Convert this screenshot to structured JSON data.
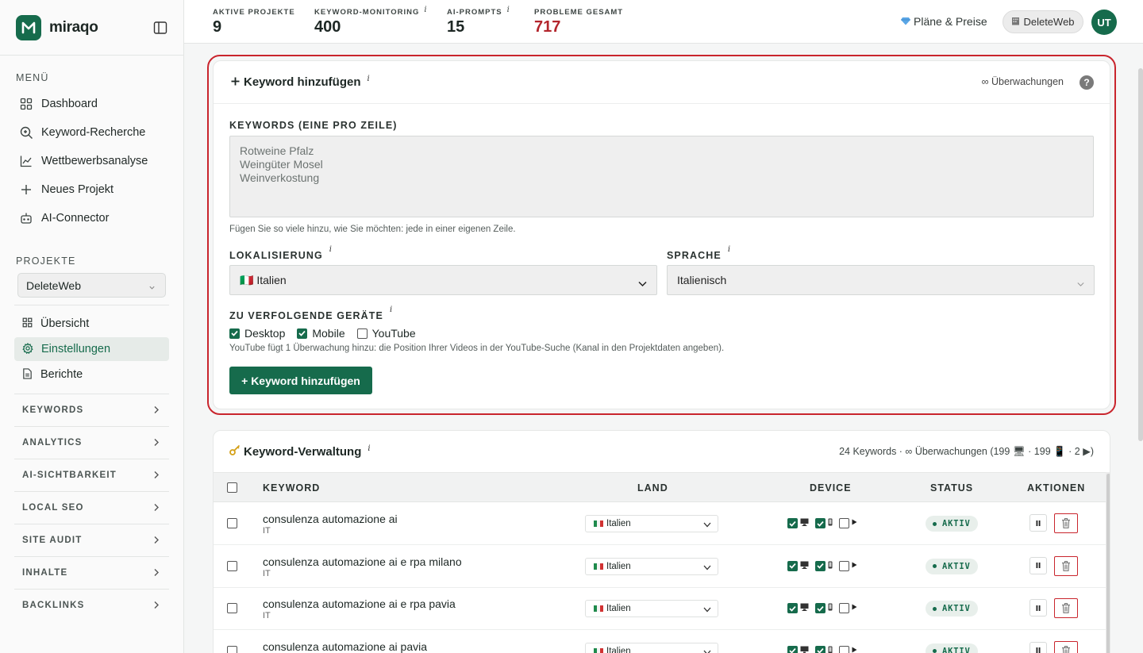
{
  "brand": {
    "name": "miraqo",
    "logo_letter": "M"
  },
  "sidebar": {
    "menu_label": "MENÜ",
    "menu": [
      {
        "label": "Dashboard",
        "icon": "grid-icon"
      },
      {
        "label": "Keyword-Recherche",
        "icon": "search-icon"
      },
      {
        "label": "Wettbewerbsanalyse",
        "icon": "chart-line-icon"
      },
      {
        "label": "Neues Projekt",
        "icon": "plus-icon"
      },
      {
        "label": "AI-Connector",
        "icon": "robot-icon"
      }
    ],
    "projects_label": "PROJEKTE",
    "project_select": "DeleteWeb",
    "project_items": [
      {
        "label": "Übersicht",
        "icon": "grid-icon",
        "active": false
      },
      {
        "label": "Einstellungen",
        "icon": "gear-icon",
        "active": true
      },
      {
        "label": "Berichte",
        "icon": "document-icon",
        "active": false
      }
    ],
    "groups": [
      "KEYWORDS",
      "ANALYTICS",
      "AI-SICHTBARKEIT",
      "LOCAL SEO",
      "SITE AUDIT",
      "INHALTE",
      "BACKLINKS"
    ]
  },
  "topbar": {
    "stats": [
      {
        "label": "AKTIVE PROJEKTE",
        "value": "9",
        "info": false,
        "alert": false
      },
      {
        "label": "KEYWORD-MONITORING",
        "value": "400",
        "info": true,
        "alert": false
      },
      {
        "label": "AI-PROMPTS",
        "value": "15",
        "info": true,
        "alert": false
      },
      {
        "label": "PROBLEME GESAMT",
        "value": "717",
        "info": false,
        "alert": true
      }
    ],
    "plans_label": "Pläne & Preise",
    "project_pill": "DeleteWeb",
    "avatar": "UT"
  },
  "add_keyword": {
    "title": "Keyword hinzufügen",
    "info_marker": "i",
    "monitoring": "∞ Überwachungen",
    "help": "?",
    "keywords_label": "KEYWORDS (EINE PRO ZEILE)",
    "keywords_placeholder": "Rotweine Pfalz\nWeingüter Mosel\nWeinverkostung",
    "keywords_hint": "Fügen Sie so viele hinzu, wie Sie möchten: jede in einer eigenen Zeile.",
    "localization_label": "LOKALISIERUNG",
    "localization_value": "🇮🇹 Italien",
    "language_label": "SPRACHE",
    "language_value": "Italienisch",
    "devices_label": "ZU VERFOLGENDE GERÄTE",
    "devices": [
      {
        "label": "Desktop",
        "checked": true
      },
      {
        "label": "Mobile",
        "checked": true
      },
      {
        "label": "YouTube",
        "checked": false
      }
    ],
    "youtube_hint": "YouTube fügt 1 Überwachung hinzu: die Position Ihrer Videos in der YouTube-Suche (Kanal in den Projektdaten angeben).",
    "submit": "+ Keyword hinzufügen"
  },
  "management": {
    "title": "Keyword-Verwaltung",
    "summary": "24 Keywords · ∞ Überwachungen (199 🖥 · 199 📱 · 2 ▶)",
    "columns": {
      "keyword": "KEYWORD",
      "land": "LAND",
      "device": "DEVICE",
      "status": "STATUS",
      "actions": "AKTIONEN"
    },
    "rows": [
      {
        "keyword": "consulenza automazione ai",
        "cc": "IT",
        "land": "Italien",
        "status": "AKTIV"
      },
      {
        "keyword": "consulenza automazione ai e rpa milano",
        "cc": "IT",
        "land": "Italien",
        "status": "AKTIV"
      },
      {
        "keyword": "consulenza automazione ai e rpa pavia",
        "cc": "IT",
        "land": "Italien",
        "status": "AKTIV"
      },
      {
        "keyword": "consulenza automazione ai pavia",
        "cc": "IT",
        "land": "Italien",
        "status": "AKTIV"
      }
    ]
  },
  "colors": {
    "brand": "#166b4c",
    "alert": "#b3252c",
    "highlight_border": "#c9252d"
  }
}
